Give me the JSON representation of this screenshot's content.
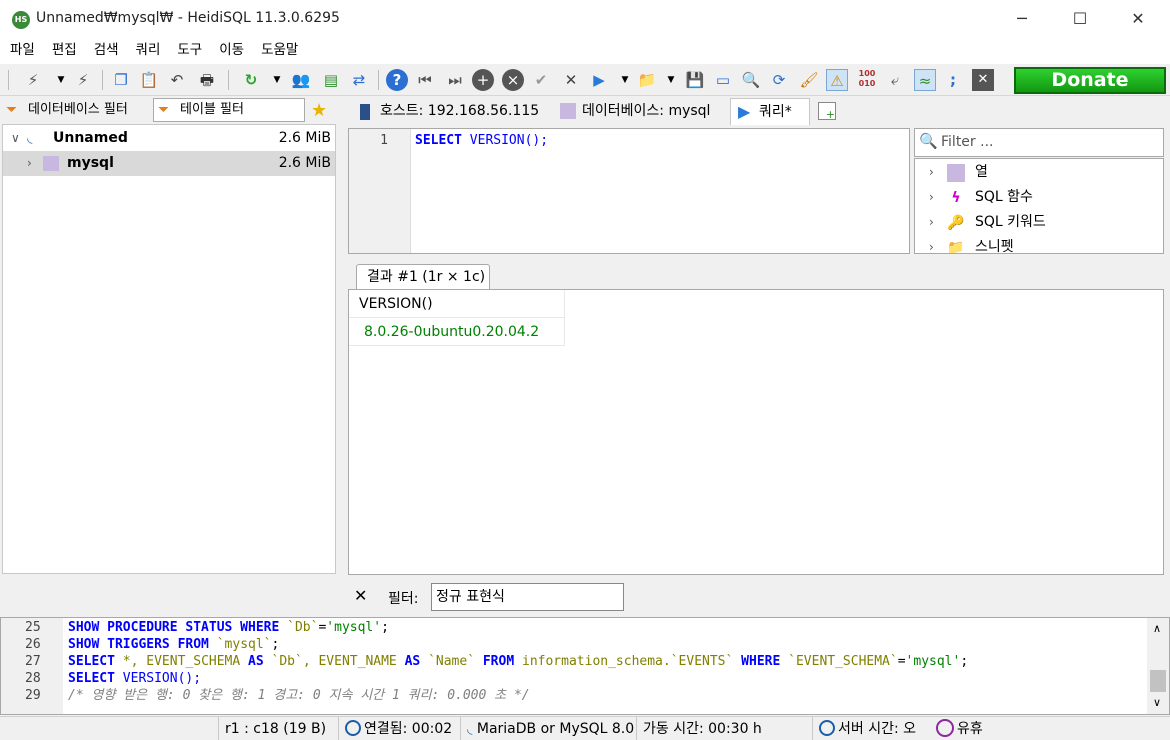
{
  "window": {
    "title": "Unnamed₩mysql₩ - HeidiSQL 11.3.0.6295",
    "app_icon_text": "HS"
  },
  "menu": [
    "파일",
    "편집",
    "검색",
    "쿼리",
    "도구",
    "이동",
    "도움말"
  ],
  "toolbar": {
    "donate_label": "Donate"
  },
  "left_panel": {
    "db_filter": "데이터베이스 필터",
    "table_filter": "테이블 필터",
    "tree": [
      {
        "name": "Unnamed",
        "size": "2.6 MiB"
      },
      {
        "name": "mysql",
        "size": "2.6 MiB"
      }
    ]
  },
  "tabs": [
    {
      "label": "호스트: 192.168.56.115"
    },
    {
      "label": "데이터베이스: mysql"
    },
    {
      "label": "쿼리*"
    }
  ],
  "editor": {
    "line_number": "1",
    "keyword": "SELECT",
    "func": "VERSION",
    "rest": "();"
  },
  "helpers": {
    "filter_placeholder": "Filter ...",
    "items": [
      "열",
      "SQL 함수",
      "SQL 키워드",
      "스니펫"
    ]
  },
  "result": {
    "tab_label": "결과 #1 (1r × 1c)",
    "column": "VERSION()",
    "value": "8.0.26-0ubuntu0.20.04.2"
  },
  "result_filter": {
    "label": "필터:",
    "value": "정규 표현식"
  },
  "log": [
    {
      "num": "25"
    },
    {
      "num": "26"
    },
    {
      "num": "27"
    },
    {
      "num": "28"
    },
    {
      "num": "29"
    }
  ],
  "log_text": {
    "l25_a": "SHOW PROCEDURE STATUS WHERE",
    "l25_b": "`Db`",
    "l25_c": "=",
    "l25_d": "'mysql'",
    "l25_e": ";",
    "l26_a": "SHOW TRIGGERS FROM",
    "l26_b": "`mysql`",
    "l26_c": ";",
    "l27_a": "SELECT",
    "l27_b": "*, EVENT_SCHEMA",
    "l27_c": "AS",
    "l27_d": "`Db`",
    "l27_e": ", EVENT_NAME",
    "l27_f": "AS",
    "l27_g": "`Name`",
    "l27_h": "FROM",
    "l27_i": "information_schema.",
    "l27_j": "`EVENTS`",
    "l27_k": "WHERE",
    "l27_l": "`EVENT_SCHEMA`",
    "l27_m": "=",
    "l27_n": "'mysql'",
    "l27_o": ";",
    "l28_a": "SELECT",
    "l28_b": "VERSION",
    "l28_c": "();",
    "l29": "/* 영향 받은 행: 0  찾은 행: 1  경고: 0  지속 시간 1 쿼리: 0.000 초 */"
  },
  "status": {
    "position": "r1 : c18 (19 B)",
    "connected": "연결됨: 00:02",
    "server_type": "MariaDB or MySQL 8.0",
    "uptime": "가동 시간: 00:30 h",
    "server_time": "서버 시간: 오",
    "idle": "유휴"
  },
  "colors": {
    "accent_blue": "#0000ff",
    "green_value": "#008000",
    "donate_green": "#1fb81f"
  }
}
